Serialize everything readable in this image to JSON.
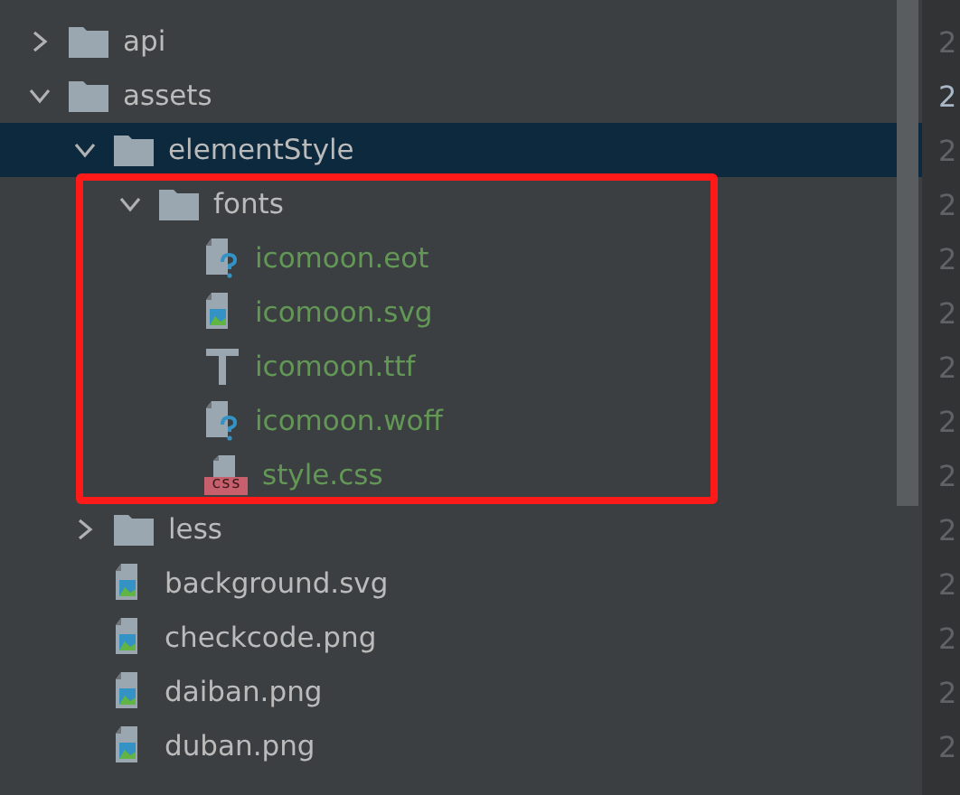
{
  "tree": [
    {
      "label": "api",
      "kind": "folder",
      "expanded": false,
      "selected": false
    },
    {
      "label": "assets",
      "kind": "folder",
      "expanded": true,
      "selected": false,
      "children": [
        {
          "label": "elementStyle",
          "kind": "folder",
          "expanded": true,
          "selected": true,
          "children": [
            {
              "label": "fonts",
              "kind": "folder",
              "expanded": true,
              "selected": false,
              "annotated": true,
              "children": [
                {
                  "label": "icomoon.eot",
                  "kind": "unknown",
                  "added": true,
                  "selected": false
                },
                {
                  "label": "icomoon.svg",
                  "kind": "image",
                  "added": true,
                  "selected": false
                },
                {
                  "label": "icomoon.ttf",
                  "kind": "font",
                  "added": true,
                  "selected": false
                },
                {
                  "label": "icomoon.woff",
                  "kind": "unknown",
                  "added": true,
                  "selected": false
                },
                {
                  "label": "style.css",
                  "kind": "css",
                  "badge": "css",
                  "added": true,
                  "selected": false
                }
              ]
            }
          ]
        },
        {
          "label": "less",
          "kind": "folder",
          "expanded": false,
          "selected": false
        },
        {
          "label": "background.svg",
          "kind": "image",
          "added": false,
          "selected": false
        },
        {
          "label": "checkcode.png",
          "kind": "image",
          "added": false,
          "selected": false
        },
        {
          "label": "daiban.png",
          "kind": "image",
          "added": false,
          "selected": false
        },
        {
          "label": "duban.png",
          "kind": "image",
          "added": false,
          "selected": false
        }
      ]
    }
  ],
  "gutter": [
    {
      "text": "2",
      "highlighted": false
    },
    {
      "text": "2",
      "highlighted": true
    },
    {
      "text": "2",
      "highlighted": false
    },
    {
      "text": "2",
      "highlighted": false
    },
    {
      "text": "2",
      "highlighted": false
    },
    {
      "text": "2",
      "highlighted": false
    },
    {
      "text": "2",
      "highlighted": false
    },
    {
      "text": "2",
      "highlighted": false
    },
    {
      "text": "2",
      "highlighted": false
    },
    {
      "text": "2",
      "highlighted": false
    },
    {
      "text": "2",
      "highlighted": false
    },
    {
      "text": "2",
      "highlighted": false
    },
    {
      "text": "2",
      "highlighted": false
    },
    {
      "text": "2",
      "highlighted": false
    }
  ]
}
